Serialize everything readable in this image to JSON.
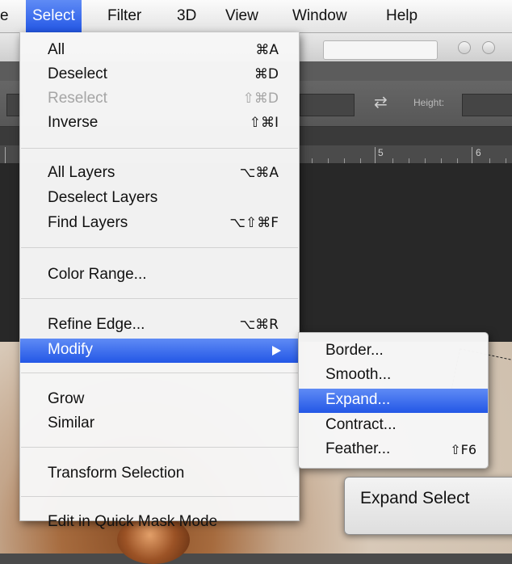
{
  "menubar": {
    "partial_left": "e",
    "items": [
      {
        "label": "Select",
        "active": true
      },
      {
        "label": "Filter"
      },
      {
        "label": "3D"
      },
      {
        "label": "View"
      },
      {
        "label": "Window"
      },
      {
        "label": "Help"
      }
    ]
  },
  "options_bar": {
    "height_label": "Height:"
  },
  "ruler": {
    "labels": [
      "5",
      "6"
    ]
  },
  "select_menu": {
    "all": {
      "label": "All",
      "shortcut": "⌘A"
    },
    "deselect": {
      "label": "Deselect",
      "shortcut": "⌘D"
    },
    "reselect": {
      "label": "Reselect",
      "shortcut": "⇧⌘D"
    },
    "inverse": {
      "label": "Inverse",
      "shortcut": "⇧⌘I"
    },
    "all_layers": {
      "label": "All Layers",
      "shortcut": "⌥⌘A"
    },
    "deselect_layers": {
      "label": "Deselect Layers"
    },
    "find_layers": {
      "label": "Find Layers",
      "shortcut": "⌥⇧⌘F"
    },
    "color_range": {
      "label": "Color Range..."
    },
    "refine_edge": {
      "label": "Refine Edge...",
      "shortcut": "⌥⌘R"
    },
    "modify": {
      "label": "Modify"
    },
    "grow": {
      "label": "Grow"
    },
    "similar": {
      "label": "Similar"
    },
    "transform_selection": {
      "label": "Transform Selection"
    },
    "edit_quick_mask": {
      "label": "Edit in Quick Mask Mode"
    }
  },
  "modify_submenu": {
    "border": {
      "label": "Border..."
    },
    "smooth": {
      "label": "Smooth..."
    },
    "expand": {
      "label": "Expand..."
    },
    "contract": {
      "label": "Contract..."
    },
    "feather": {
      "label": "Feather...",
      "shortcut": "⇧F6"
    }
  },
  "dialog": {
    "title": "Expand Select"
  }
}
